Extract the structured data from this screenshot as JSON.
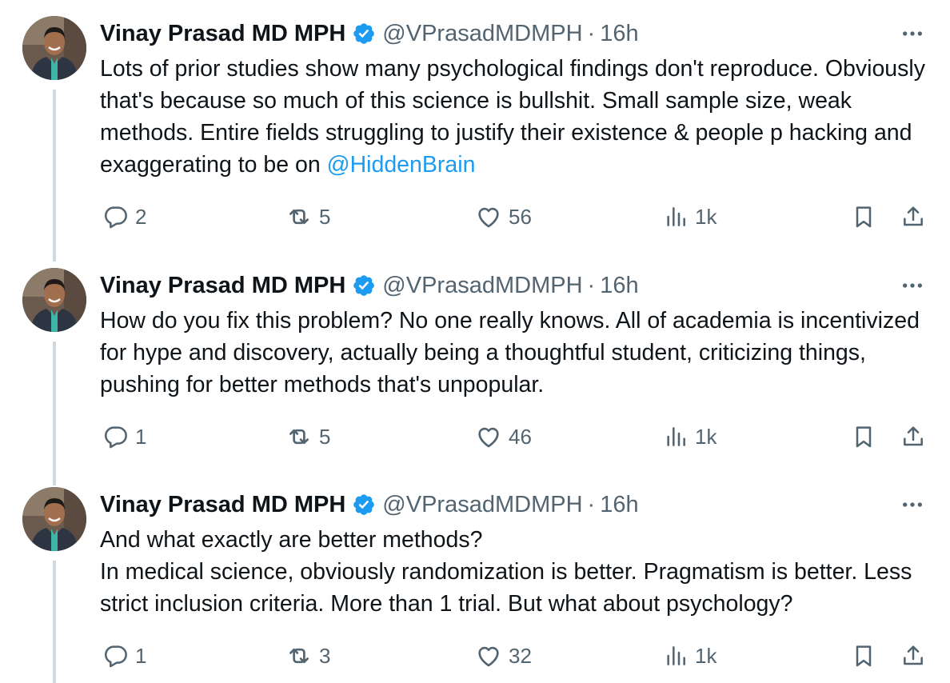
{
  "colors": {
    "text": "#0f1419",
    "secondary": "#536471",
    "link": "#1d9bf0",
    "verified": "#1d9bf0",
    "thread_line": "#cfd9de"
  },
  "icons": {
    "more": "more-horizontal-icon",
    "verified": "verified-badge-icon",
    "reply": "reply-bubble-icon",
    "retweet": "retweet-icon",
    "like": "heart-icon",
    "views": "views-bar-chart-icon",
    "bookmark": "bookmark-icon",
    "share": "share-upload-icon"
  },
  "tweets": [
    {
      "author": {
        "name": "Vinay Prasad MD MPH",
        "handle": "@VPrasadMDMPH",
        "separator": "·",
        "time": "16h"
      },
      "text": {
        "lines": [
          "Lots of prior studies show many psychological findings don't reproduce. Obviously that's because so much of this science is bullshit. Small sample size, weak methods. Entire fields struggling to justify their existence & people p hacking and exaggerating to be on "
        ],
        "mention": "@HiddenBrain"
      },
      "stats": {
        "replies": "2",
        "retweets": "5",
        "likes": "56",
        "views": "1k"
      }
    },
    {
      "author": {
        "name": "Vinay Prasad MD MPH",
        "handle": "@VPrasadMDMPH",
        "separator": "·",
        "time": "16h"
      },
      "text": {
        "lines": [
          "How do you fix this problem? No one really knows. All of academia is incentivized for hype and discovery, actually being a thoughtful student, criticizing things, pushing for better methods that's unpopular."
        ]
      },
      "stats": {
        "replies": "1",
        "retweets": "5",
        "likes": "46",
        "views": "1k"
      }
    },
    {
      "author": {
        "name": "Vinay Prasad MD MPH",
        "handle": "@VPrasadMDMPH",
        "separator": "·",
        "time": "16h"
      },
      "text": {
        "lines": [
          "And what exactly are better methods?",
          "In medical science, obviously randomization is better. Pragmatism is better. Less strict inclusion criteria. More than 1 trial. But what about psychology?"
        ]
      },
      "stats": {
        "replies": "1",
        "retweets": "3",
        "likes": "32",
        "views": "1k"
      }
    }
  ]
}
